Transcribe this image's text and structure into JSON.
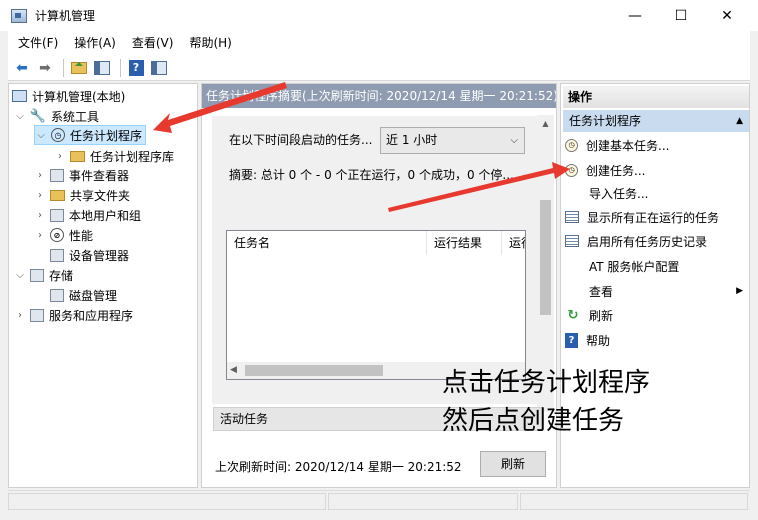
{
  "window": {
    "title": "计算机管理",
    "minimize": "—",
    "maximize": "☐",
    "close": "✕"
  },
  "menu": [
    "文件(F)",
    "操作(A)",
    "查看(V)",
    "帮助(H)"
  ],
  "toolbar": {
    "back": "⬅",
    "forward": "➡",
    "help": "?"
  },
  "tree": {
    "root": "计算机管理(本地)",
    "system_tools": "系统工具",
    "task_scheduler": "任务计划程序",
    "task_scheduler_library": "任务计划程序库",
    "event_viewer": "事件查看器",
    "shared_folders": "共享文件夹",
    "local_users_groups": "本地用户和组",
    "performance": "性能",
    "device_manager": "设备管理器",
    "storage": "存储",
    "disk_management": "磁盘管理",
    "services_apps": "服务和应用程序"
  },
  "center": {
    "header": "任务计划程序摘要(上次刷新时间: 2020/12/14 星期一 20:21:52)",
    "filter_label": "在以下时间段启动的任务...",
    "filter_value": "近 1 小时",
    "summary": "摘要: 总计 0 个 - 0 个正在运行，0 个成功，0 个停...",
    "columns": [
      "任务名",
      "运行结果",
      "运行"
    ],
    "active_tasks": "活动任务",
    "last_refresh": "上次刷新时间: 2020/12/14 星期一 20:21:52",
    "refresh_button": "刷新"
  },
  "actions": {
    "header": "操作",
    "section": "任务计划程序",
    "items": [
      "创建基本任务...",
      "创建任务...",
      "导入任务...",
      "显示所有正在运行的任务",
      "启用所有任务历史记录",
      "AT 服务帐户配置",
      "查看",
      "刷新",
      "帮助"
    ]
  },
  "annotation": {
    "line1": "点击任务计划程序",
    "line2": "然后点创建任务",
    "arrow_color": "#e8392f"
  }
}
